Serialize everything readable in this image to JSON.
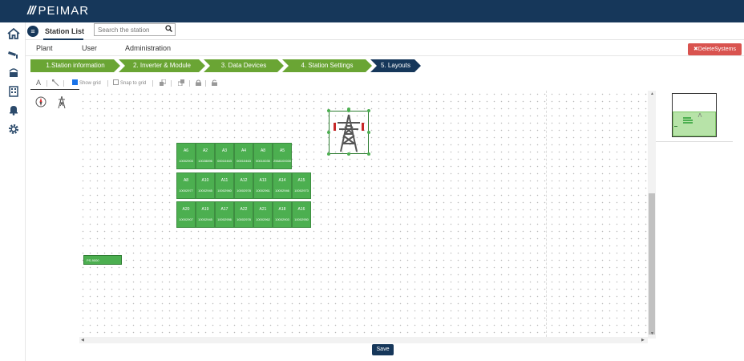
{
  "app": {
    "brand": "PEIMAR"
  },
  "sidebar": {
    "icons": [
      "home-icon",
      "camera-icon",
      "inverter-icon",
      "building-icon",
      "bell-icon",
      "gear-icon"
    ]
  },
  "header": {
    "title": "Station List",
    "search_placeholder": "Search the station"
  },
  "tabs": [
    {
      "label": "Plant"
    },
    {
      "label": "User"
    },
    {
      "label": "Administration"
    }
  ],
  "actions": {
    "delete_label": "✖DeleteSystems",
    "save_label": "Save"
  },
  "steps": [
    {
      "label": "1.Station information",
      "state": "done"
    },
    {
      "label": "2. Inverter & Module",
      "state": "done"
    },
    {
      "label": "3. Data Devices",
      "state": "done"
    },
    {
      "label": "4. Station Settings",
      "state": "done"
    },
    {
      "label": "5. Layouts",
      "state": "active"
    }
  ],
  "toolbar": {
    "text_tool": "A",
    "show_grid_label": "Show grid",
    "show_grid_checked": true,
    "snap_grid_label": "Snap to grid",
    "snap_grid_checked": false
  },
  "canvas": {
    "modules_row1": [
      {
        "name": "A6",
        "serial": "10002903"
      },
      {
        "name": "A2",
        "serial": "10028896"
      },
      {
        "name": "A3",
        "serial": "00010463"
      },
      {
        "name": "A4",
        "serial": "00010463"
      },
      {
        "name": "A8",
        "serial": "00010035"
      },
      {
        "name": "A5",
        "serial": "2568100030"
      }
    ],
    "modules_row2": [
      {
        "name": "A8",
        "serial": "10002977"
      },
      {
        "name": "A10",
        "serial": "10002945"
      },
      {
        "name": "A11",
        "serial": "10002960"
      },
      {
        "name": "A12",
        "serial": "10002978"
      },
      {
        "name": "A13",
        "serial": "10002961"
      },
      {
        "name": "A14",
        "serial": "10002946"
      },
      {
        "name": "A15",
        "serial": "10002973"
      }
    ],
    "modules_row3": [
      {
        "name": "A20",
        "serial": "10002907"
      },
      {
        "name": "A19",
        "serial": "10002945"
      },
      {
        "name": "A17",
        "serial": "10002956"
      },
      {
        "name": "A22",
        "serial": "10002978"
      },
      {
        "name": "A21",
        "serial": "10002962"
      },
      {
        "name": "A18",
        "serial": "10002903"
      },
      {
        "name": "A16",
        "serial": "10002950"
      }
    ],
    "inverter_label": "PS-9000"
  },
  "colors": {
    "brand": "#16375a",
    "step_done": "#6aa534",
    "module": "#4caf50",
    "danger": "#d9534f"
  }
}
